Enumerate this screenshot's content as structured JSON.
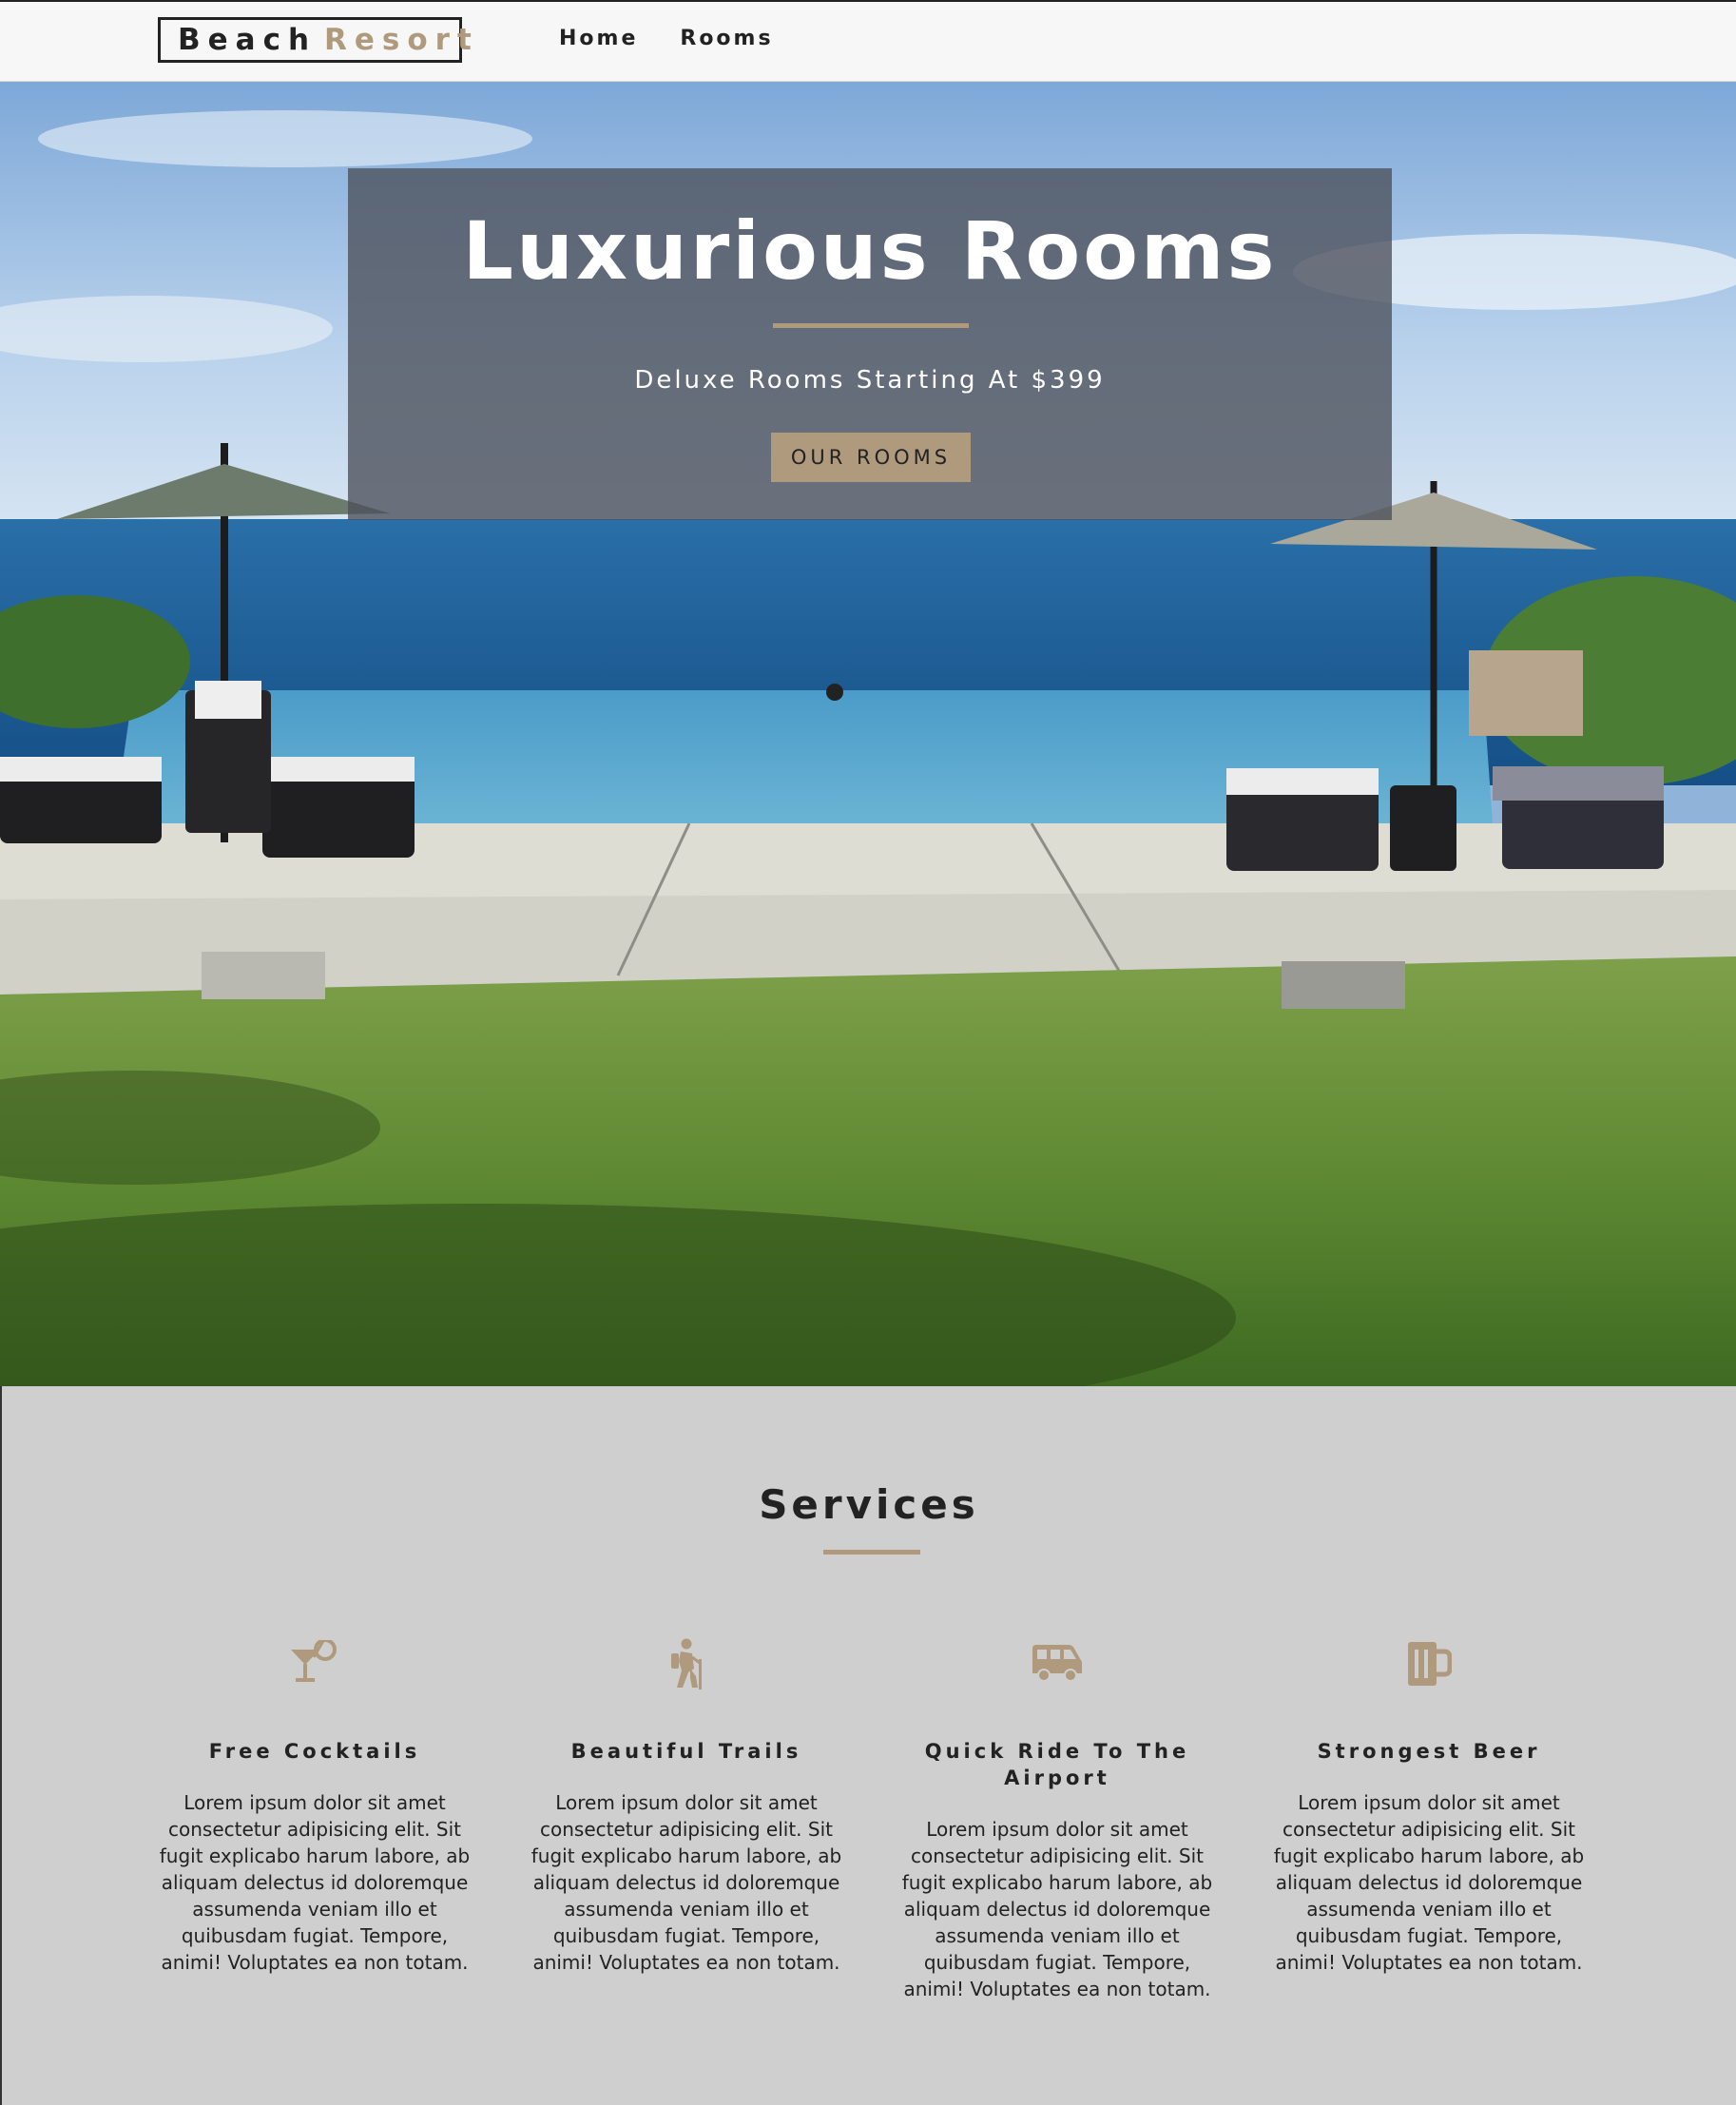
{
  "navbar": {
    "logo_word1": "Beach",
    "logo_word2": "Resort",
    "links": [
      "Home",
      "Rooms"
    ]
  },
  "hero": {
    "title": "Luxurious Rooms",
    "subtitle": "Deluxe Rooms Starting At $399",
    "button_label": "OUR ROOMS"
  },
  "services": {
    "title": "Services",
    "items": [
      {
        "icon": "cocktail-icon",
        "title": "Free Cocktails",
        "text": "Lorem ipsum dolor sit amet consectetur adipisicing elit. Sit fugit explicabo harum labore, ab aliquam delectus id doloremque assumenda veniam illo et quibusdam fugiat. Tempore, animi! Voluptates ea non totam."
      },
      {
        "icon": "hiking-icon",
        "title": "Beautiful Trails",
        "text": "Lorem ipsum dolor sit amet consectetur adipisicing elit. Sit fugit explicabo harum labore, ab aliquam delectus id doloremque assumenda veniam illo et quibusdam fugiat. Tempore, animi! Voluptates ea non totam."
      },
      {
        "icon": "shuttle-van-icon",
        "title": "Quick Ride To The Airport",
        "text": "Lorem ipsum dolor sit amet consectetur adipisicing elit. Sit fugit explicabo harum labore, ab aliquam delectus id doloremque assumenda veniam illo et quibusdam fugiat. Tempore, animi! Voluptates ea non totam."
      },
      {
        "icon": "beer-mug-icon",
        "title": "Strongest Beer",
        "text": "Lorem ipsum dolor sit amet consectetur adipisicing elit. Sit fugit explicabo harum labore, ab aliquam delectus id doloremque assumenda veniam illo et quibusdam fugiat. Tempore, animi! Voluptates ea non totam."
      }
    ]
  },
  "colors": {
    "accent": "#af9a7d",
    "dark": "#222222",
    "services_bg": "#cfcfcf"
  }
}
